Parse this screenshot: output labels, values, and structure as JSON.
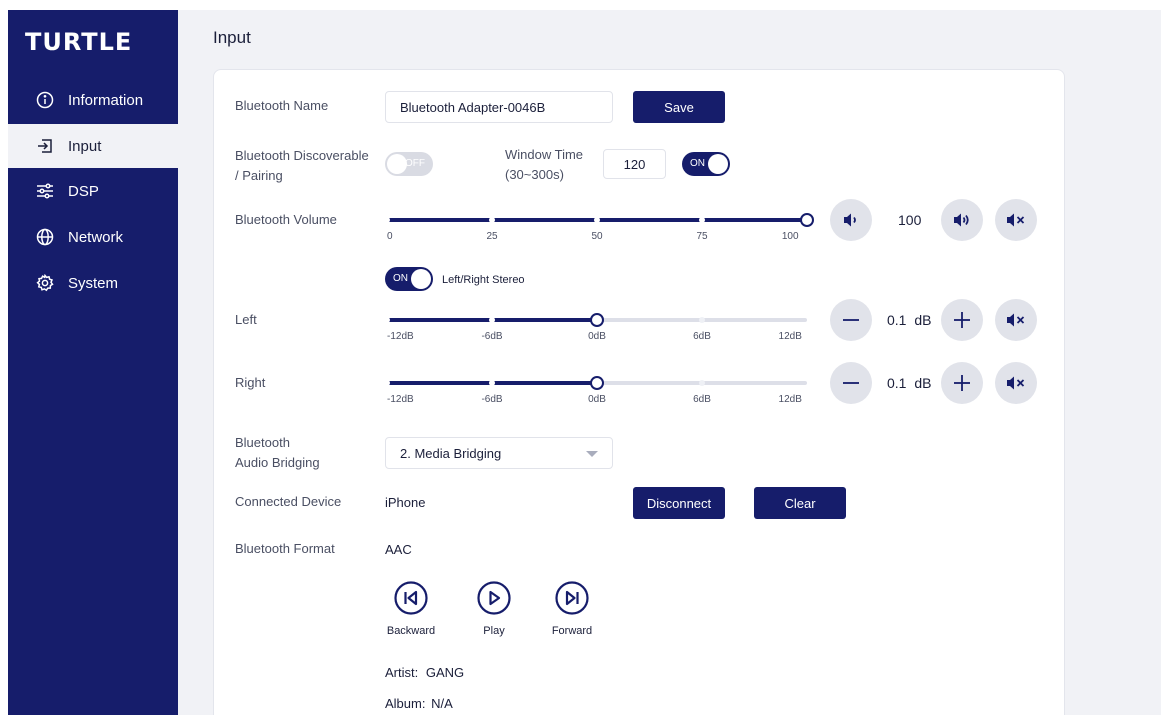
{
  "app": {
    "logo": "TURTLE",
    "page_title": "Input"
  },
  "sidebar": {
    "items": [
      {
        "label": "Information",
        "icon": "info-icon",
        "active": false
      },
      {
        "label": "Input",
        "icon": "input-icon",
        "active": true
      },
      {
        "label": "DSP",
        "icon": "sliders-icon",
        "active": false
      },
      {
        "label": "Network",
        "icon": "globe-icon",
        "active": false
      },
      {
        "label": "System",
        "icon": "gear-icon",
        "active": false
      }
    ]
  },
  "bluetooth_name": {
    "label": "Bluetooth Name",
    "value": "Bluetooth Adapter-0046B",
    "save_label": "Save"
  },
  "discoverable": {
    "label_line1": "Bluetooth Discoverable",
    "label_line2": "/ Pairing",
    "toggle_text": "OFF",
    "toggle_state": "off",
    "window_label_line1": "Window Time",
    "window_label_line2": "(30~300s)",
    "window_value": "120",
    "window_toggle_text": "ON",
    "window_toggle_state": "on"
  },
  "volume": {
    "label": "Bluetooth Volume",
    "value": 100,
    "value_text": "100",
    "min": 0,
    "max": 100,
    "ticks": [
      "0",
      "25",
      "50",
      "75",
      "100"
    ]
  },
  "stereo": {
    "toggle_text": "ON",
    "toggle_state": "on",
    "label": "Left/Right Stereo"
  },
  "left": {
    "label": "Left",
    "level_fraction": 0.5,
    "value": "0.1",
    "unit": "dB",
    "ticks": [
      "-12dB",
      "-6dB",
      "0dB",
      "6dB",
      "12dB"
    ]
  },
  "right": {
    "label": "Right",
    "level_fraction": 0.5,
    "value": "0.1",
    "unit": "dB",
    "ticks": [
      "-12dB",
      "-6dB",
      "0dB",
      "6dB",
      "12dB"
    ]
  },
  "bridging": {
    "label_line1": "Bluetooth",
    "label_line2": "Audio Bridging",
    "selected": "2. Media Bridging"
  },
  "connected": {
    "label": "Connected Device",
    "value": "iPhone",
    "disconnect_label": "Disconnect",
    "clear_label": "Clear"
  },
  "format": {
    "label": "Bluetooth Format",
    "value": "AAC"
  },
  "media": {
    "backward": "Backward",
    "play": "Play",
    "forward": "Forward"
  },
  "track": {
    "artist_label": "Artist:",
    "artist": "GANG",
    "album_label": "Album:",
    "album": "N/A"
  },
  "colors": {
    "primary": "#161d6b",
    "background": "#f1f2f6",
    "button_gray": "#e1e3ea",
    "track": "#dddfe8"
  }
}
